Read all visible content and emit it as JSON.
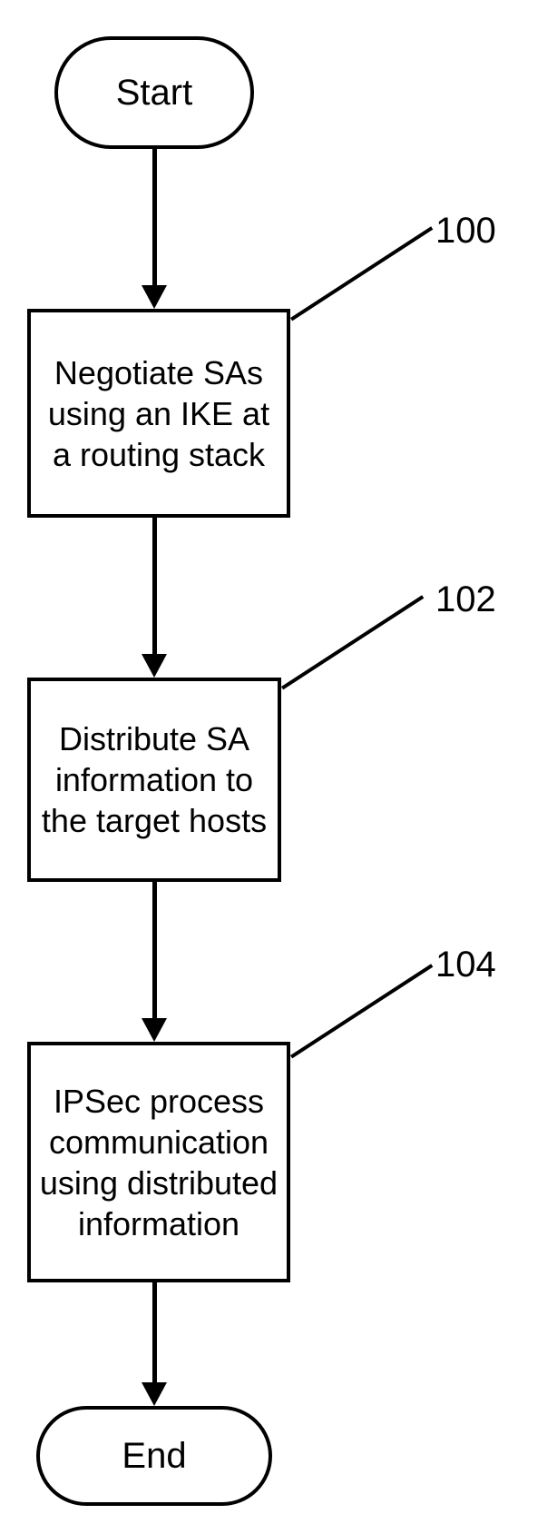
{
  "terminators": {
    "start": "Start",
    "end": "End"
  },
  "steps": {
    "s100": "Negotiate SAs using an IKE at a routing stack",
    "s102": "Distribute SA information to the target hosts",
    "s104": "IPSec process communication using distributed information"
  },
  "refs": {
    "r100": "100",
    "r102": "102",
    "r104": "104"
  }
}
